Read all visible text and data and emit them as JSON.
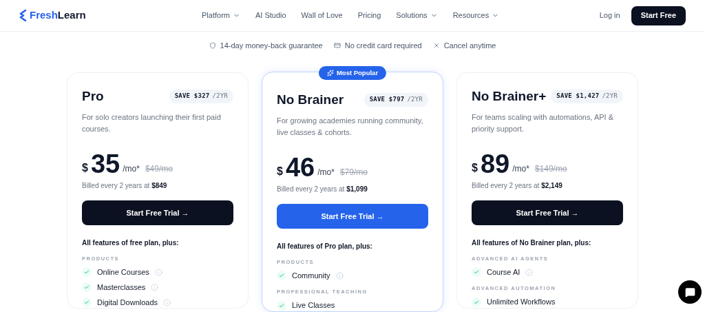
{
  "brand": {
    "name_a": "Fresh",
    "name_b": "Learn"
  },
  "nav": [
    {
      "label": "Platform",
      "dropdown": true
    },
    {
      "label": "AI Studio",
      "dropdown": false
    },
    {
      "label": "Wall of Love",
      "dropdown": false
    },
    {
      "label": "Pricing",
      "dropdown": false
    },
    {
      "label": "Solutions",
      "dropdown": true
    },
    {
      "label": "Resources",
      "dropdown": true
    }
  ],
  "login": "Log in",
  "cta": "Start Free",
  "trust": [
    {
      "kind": "shield",
      "text": "14-day money-back guarantee"
    },
    {
      "kind": "card",
      "text": "No credit card required"
    },
    {
      "kind": "x",
      "text": "Cancel anytime"
    }
  ],
  "plans": [
    {
      "name": "Pro",
      "featured": false,
      "save": "SAVE $327",
      "period": "/2YR",
      "description": "For solo creators launching their first paid courses.",
      "currency": "$",
      "price": "35",
      "unit": "/mo*",
      "old_price": "$49/mo",
      "billed": "Billed every 2 years at",
      "billed_total": "$849",
      "button": "Start Free Trial →",
      "includes": "All features of free plan, plus:",
      "groups": [
        {
          "title": "PRODUCTS",
          "items": [
            {
              "label": "Online Courses",
              "info": true
            },
            {
              "label": "Masterclasses",
              "info": true
            },
            {
              "label": "Digital Downloads",
              "info": true
            }
          ]
        }
      ]
    },
    {
      "name": "No Brainer",
      "featured": true,
      "badge": "Most Popular",
      "save": "SAVE $797",
      "period": "/2YR",
      "description": "For growing academies running community, live classes & cohorts.",
      "currency": "$",
      "price": "46",
      "unit": "/mo*",
      "old_price": "$79/mo",
      "billed": "Billed every 2 years at",
      "billed_total": "$1,099",
      "button": "Start Free Trial →",
      "includes": "All features of Pro plan, plus:",
      "groups": [
        {
          "title": "PRODUCTS",
          "items": [
            {
              "label": "Community",
              "info": true
            }
          ]
        },
        {
          "title": "PROFESSIONAL TEACHING",
          "items": [
            {
              "label": "Live Classes",
              "info": false
            }
          ]
        }
      ]
    },
    {
      "name": "No Brainer+",
      "featured": false,
      "save": "SAVE $1,427",
      "period": "/2YR",
      "description": "For teams scaling with automations, API & priority support.",
      "currency": "$",
      "price": "89",
      "unit": "/mo*",
      "old_price": "$149/mo",
      "billed": "Billed every 2 years at",
      "billed_total": "$2,149",
      "button": "Start Free Trial →",
      "includes": "All features of No Brainer plan, plus:",
      "groups": [
        {
          "title": "ADVANCED AI AGENTS",
          "items": [
            {
              "label": "Course AI",
              "info": true
            }
          ]
        },
        {
          "title": "ADVANCED AUTOMATION",
          "items": [
            {
              "label": "Unlimited Workflows",
              "info": false
            }
          ]
        }
      ]
    }
  ]
}
